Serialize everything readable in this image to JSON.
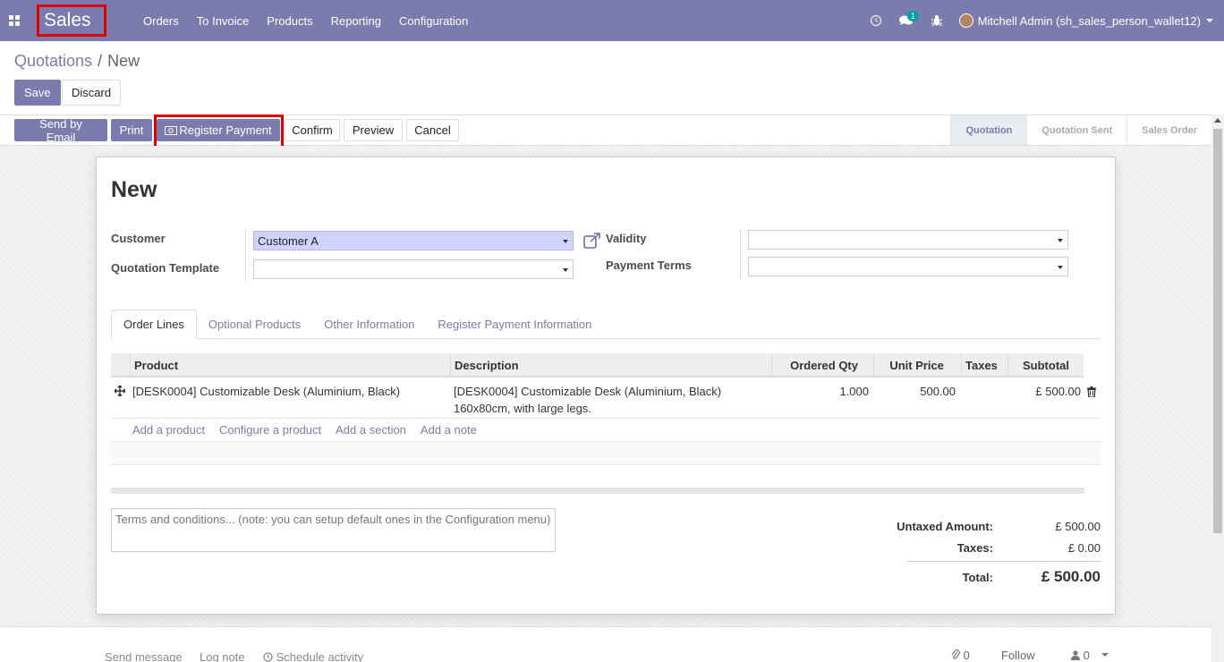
{
  "navbar": {
    "brand": "Sales",
    "menu": [
      "Orders",
      "To Invoice",
      "Products",
      "Reporting",
      "Configuration"
    ],
    "messages_count": "1",
    "user": "Mitchell Admin (sh_sales_person_wallet12)"
  },
  "breadcrumb": {
    "parent": "Quotations",
    "sep": "/",
    "current": "New"
  },
  "control": {
    "save": "Save",
    "discard": "Discard"
  },
  "header": {
    "send_email": "Send by Email",
    "print": "Print",
    "register_payment": "Register Payment",
    "confirm": "Confirm",
    "preview": "Preview",
    "cancel": "Cancel",
    "stages": [
      "Quotation",
      "Quotation Sent",
      "Sales Order"
    ]
  },
  "form": {
    "title": "New",
    "customer_label": "Customer",
    "customer_value": "Customer A",
    "template_label": "Quotation Template",
    "template_value": "",
    "validity_label": "Validity",
    "validity_value": "",
    "payment_terms_label": "Payment Terms",
    "payment_terms_value": ""
  },
  "tabs": [
    "Order Lines",
    "Optional Products",
    "Other Information",
    "Register Payment Information"
  ],
  "table": {
    "columns": [
      "Product",
      "Description",
      "Ordered Qty",
      "Unit Price",
      "Taxes",
      "Subtotal"
    ],
    "rows": [
      {
        "product": "[DESK0004] Customizable Desk (Aluminium, Black)",
        "description_line1": "[DESK0004] Customizable Desk (Aluminium, Black)",
        "description_line2": "160x80cm, with large legs.",
        "qty": "1.000",
        "price": "500.00",
        "taxes": "",
        "subtotal": "£ 500.00"
      }
    ],
    "add_links": [
      "Add a product",
      "Configure a product",
      "Add a section",
      "Add a note"
    ]
  },
  "terms_placeholder": "Terms and conditions... (note: you can setup default ones in the Configuration menu)",
  "totals": {
    "untaxed_label": "Untaxed Amount:",
    "untaxed_value": "£ 500.00",
    "taxes_label": "Taxes:",
    "taxes_value": "£ 0.00",
    "total_label": "Total:",
    "total_value": "£ 500.00"
  },
  "chatter": {
    "send_message": "Send message",
    "log_note": "Log note",
    "schedule_activity": "Schedule activity",
    "attachments": "0",
    "follow": "Follow",
    "followers": "0"
  },
  "colors": {
    "brand": "#7c7bad",
    "highlight": "#e00000",
    "customer_field": "#d2d2ff"
  }
}
